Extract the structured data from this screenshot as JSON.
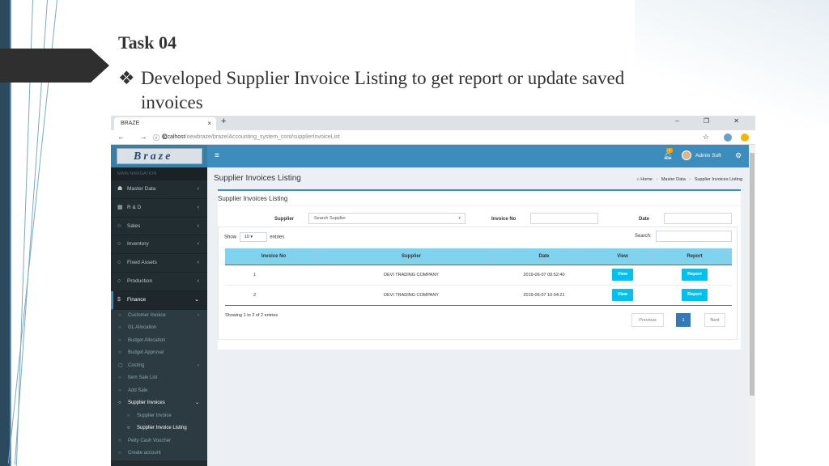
{
  "slide": {
    "title": "Task 04",
    "bullet_symbol": "❖",
    "bullet_line1": "Developed Supplier Invoice Listing to get report or update saved",
    "bullet_line2": "invoices"
  },
  "browser": {
    "tab_title": "BRAZE",
    "tab_close": "×",
    "new_tab": "+",
    "window_controls": "– ❐ ✕",
    "nav_buttons": "← → C",
    "info_icon": "ⓘ",
    "url_host": "localhost",
    "url_path": "/oewbraze/braze/Accounting_system_cont/supplierInvoiceList",
    "star": "☆"
  },
  "sidebar": {
    "logo_text": "Braze",
    "section_label": "MAIN NAVIGATION",
    "items": [
      {
        "icon": "☗",
        "label": "Master Data",
        "chev": "‹"
      },
      {
        "icon": "▦",
        "label": "R & D",
        "chev": "‹"
      },
      {
        "icon": "○",
        "label": "Sales",
        "chev": "‹"
      },
      {
        "icon": "○",
        "label": "Inventory",
        "chev": "‹"
      },
      {
        "icon": "○",
        "label": "Fixed Assets",
        "chev": "‹"
      },
      {
        "icon": "○",
        "label": "Production",
        "chev": "‹"
      },
      {
        "icon": "$",
        "label": "Finance",
        "chev": "⌄"
      }
    ],
    "finance_sub": [
      {
        "icon": "○",
        "label": "Customer Invoice",
        "chev": "‹"
      },
      {
        "icon": "○",
        "label": "GL Allocation",
        "chev": ""
      },
      {
        "icon": "○",
        "label": "Budget Allocation",
        "chev": ""
      },
      {
        "icon": "○",
        "label": "Budget Approval",
        "chev": ""
      },
      {
        "icon": "▢",
        "label": "Costing",
        "chev": "‹"
      },
      {
        "icon": "○",
        "label": "Item Sale List",
        "chev": ""
      },
      {
        "icon": "○",
        "label": "Add Sale",
        "chev": ""
      },
      {
        "icon": "○",
        "label": "Supplier Invoices",
        "chev": "⌄"
      },
      {
        "icon": "○",
        "label": "Supplier Invoice",
        "chev": ""
      },
      {
        "icon": "○",
        "label": "Supplier Invoice Listing",
        "chev": ""
      },
      {
        "icon": "○",
        "label": "Petty Cash Voucher",
        "chev": ""
      },
      {
        "icon": "○",
        "label": "Create account",
        "chev": ""
      }
    ]
  },
  "topbar": {
    "menu_icon": "≡",
    "bell_icon": "🔔",
    "notif_count": "4",
    "user_name": "Admin Soft",
    "settings_icon": "⚙"
  },
  "page": {
    "header": "Supplier Invoices Listing",
    "breadcrumb": {
      "home_icon": "⌂",
      "home": "Home",
      "sep": "›",
      "master": "Master Data",
      "current": "Supplier Invoices Listing"
    },
    "box_title": "Supplier Invoices Listing",
    "filters": {
      "supplier_label": "Supplier",
      "supplier_placeholder": "Search Supplier",
      "invoice_label": "Invoice No",
      "invoice_value": "",
      "date_label": "Date",
      "date_value": ""
    },
    "table": {
      "show_label": "Show",
      "entries_value": "10",
      "entries_label": "entries",
      "search_label": "Search:",
      "columns": [
        "Invoice No",
        "Supplier",
        "Date",
        "View",
        "Report"
      ],
      "sort_icon": "⇅",
      "rows": [
        {
          "no": "1",
          "supplier": "DEVI TRADING COMPANY",
          "date": "2019-06-07 09:52:40",
          "view": "View",
          "report": "Report"
        },
        {
          "no": "2",
          "supplier": "DEVI TRADING COMPANY",
          "date": "2019-06-07 10:04:21",
          "view": "View",
          "report": "Report"
        }
      ],
      "showing": "Showing 1 to 2 of 2 entries",
      "pager": {
        "prev": "Previous",
        "page": "1",
        "next": "Next"
      }
    }
  },
  "colors": {
    "topbar": "#3c8dbc",
    "sidebar": "#222d32",
    "header_row": "#7fd3ef",
    "button": "#00c0ef",
    "page_active": "#337ab7"
  }
}
